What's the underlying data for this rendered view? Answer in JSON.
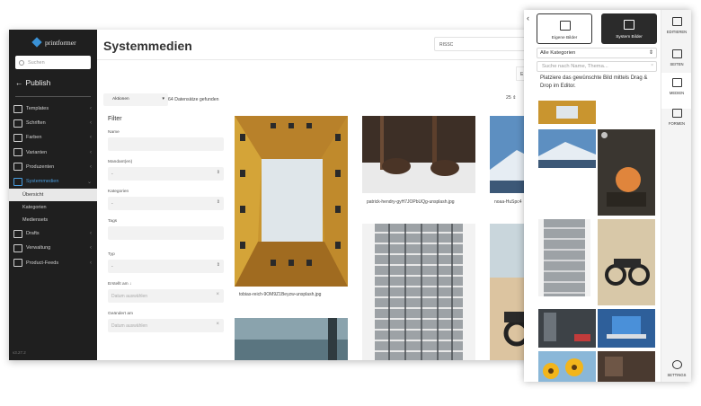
{
  "sidebar": {
    "brand": "printformer",
    "search_placeholder": "Suchen",
    "publish_label": "Publish",
    "items": [
      {
        "label": "Templates",
        "chevron": "‹"
      },
      {
        "label": "Schriften",
        "chevron": "‹"
      },
      {
        "label": "Farben",
        "chevron": "‹"
      },
      {
        "label": "Varianten",
        "chevron": "‹"
      },
      {
        "label": "Produzenten",
        "chevron": "‹"
      },
      {
        "label": "Systemmedien",
        "chevron": "⌄"
      }
    ],
    "sub_items": [
      {
        "label": "Übersicht"
      },
      {
        "label": "Kategorien"
      },
      {
        "label": "Mediensets"
      }
    ],
    "items_after": [
      {
        "label": "Drafts",
        "chevron": "‹"
      },
      {
        "label": "Verwaltung",
        "chevron": "‹"
      },
      {
        "label": "Product-Feeds",
        "chevron": "‹"
      }
    ],
    "version": "v3.27.2"
  },
  "main": {
    "title": "Systemmedien",
    "tenant": "RISSC",
    "actions_label": "Aktionen",
    "result_count": "64 Datensätze gefunden",
    "per_page": "25",
    "right_chip": "E"
  },
  "filter": {
    "title": "Filter",
    "name_label": "Name",
    "tenant_label": "Mandant(en)",
    "tenant_value": "-",
    "categories_label": "Kategorien",
    "categories_value": "-",
    "tags_label": "Tags",
    "type_label": "Typ",
    "type_value": "-",
    "created_label": "Erstellt am ↓",
    "created_placeholder": "Datum auswählen",
    "changed_label": "Geändert am",
    "changed_placeholder": "Datum auswählen"
  },
  "media": [
    {
      "caption": "tobias-reich-9OM9Z1Beyzw-unsplash.jpg"
    },
    {
      "caption": "patrick-hendry-gyH7JOPbUQg-unsplash.jpg"
    },
    {
      "caption": "noaa-HuSpc4"
    }
  ],
  "panel": {
    "own_images": "Eigene Bilder",
    "system_images": "System Bilder",
    "category_select": "Alle Kategorien",
    "search_placeholder": "Suche nach Name, Thema...",
    "hint": "Platziere das gewünschte Bild mittels Drag & Drop im Editor.",
    "rail": [
      {
        "label": "EDITIEREN",
        "icon": "text-icon"
      },
      {
        "label": "SEITEN",
        "icon": "pages-icon"
      },
      {
        "label": "MEDIEN",
        "icon": "image-icon"
      },
      {
        "label": "FORMEN",
        "icon": "shapes-icon"
      },
      {
        "label": "SETTINGS",
        "icon": "gear-icon"
      }
    ]
  },
  "colors": {
    "sidebar_bg": "#1f1f1f",
    "accent": "#4a9ee0",
    "system_tab_bg": "#2b2b2b"
  }
}
